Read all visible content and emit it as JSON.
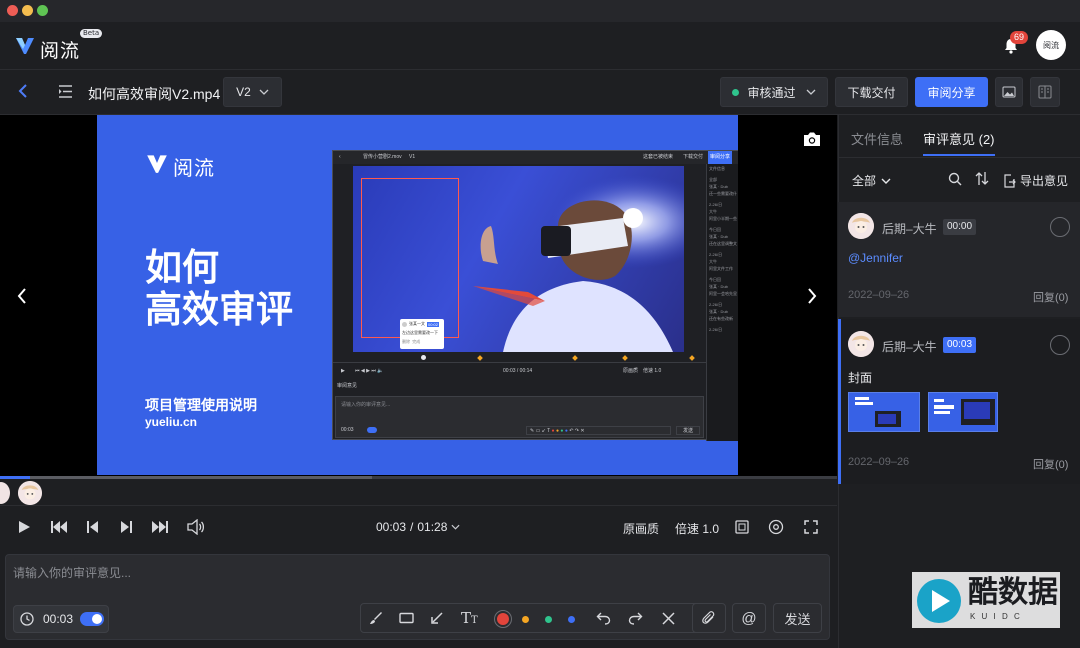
{
  "app": {
    "name": "阅流",
    "beta": "Beta",
    "notifications": "69",
    "avatar_text": "阅流"
  },
  "toolbar": {
    "file_name": "如何高效审阅V2.mp4",
    "version": "V2",
    "status_label": "审核通过",
    "status_color": "#2fc48d",
    "download_label": "下载交付",
    "share_label": "审阅分享",
    "accent_color": "#3e6ff6"
  },
  "slide": {
    "brand": "阅流",
    "title_line1": "如何",
    "title_line2": "高效审评",
    "subtitle": "项目管理使用说明",
    "url": "yueliu.cn",
    "inner_ui": {
      "file": "冒传小营剧2.mov",
      "version": "V1",
      "status": "这套已被结束",
      "download": "下载交付",
      "share": "审阅分享",
      "tab": "文件信息",
      "popup_name": "张某一文",
      "popup_badge": "00:02",
      "popup_text": "左边这里需要改一下",
      "popup_actions": [
        "删除",
        "完成"
      ],
      "time": "00:03 / 00:14",
      "quality": "原画质",
      "speed": "倍速 1.0",
      "section": "审阅意见",
      "input_placeholder": "请输入你的审评意见...",
      "input_time": "00:03",
      "send": "发送",
      "side_items": [
        "全部",
        "张某 · Dub",
        "还一些需要改什么",
        "2-26/日",
        "大牛",
        "阿里小半期一些",
        "今日回",
        "张某 · Dub",
        "还在这里调整文件",
        "2-26/日",
        "大牛",
        "阿里文件工作",
        "今日回",
        "张某 · Dub",
        "阿里一会哈先显示",
        "2-26/日",
        "张某 · Dub",
        "还在有些改新",
        "2-26/日"
      ]
    }
  },
  "player": {
    "current_time": "00:03",
    "duration": "01:28",
    "quality": "原画质",
    "speed_label": "倍速 1.0",
    "progress": 0.036
  },
  "comment_input": {
    "placeholder": "请输入你的审评意见...",
    "time": "00:03",
    "send_label": "发送",
    "colors": [
      "#e2443b",
      "#f5a623",
      "#2fc48d",
      "#3e6ff6"
    ]
  },
  "panel": {
    "tabs": [
      {
        "label": "文件信息"
      },
      {
        "label": "审评意见 (2)"
      }
    ],
    "filter": "全部",
    "export_label": "导出意见",
    "comments": [
      {
        "user": "后期–大牛",
        "time": "00:00",
        "text": "@Jennifer",
        "date": "2022–09–26",
        "reply": "回复(0)"
      },
      {
        "user": "后期–大牛",
        "time": "00:03",
        "text": "封面",
        "date": "2022–09–26",
        "reply": "回复(0)"
      }
    ]
  },
  "watermark": {
    "text": "酷数据",
    "sub": "K U I D C"
  }
}
